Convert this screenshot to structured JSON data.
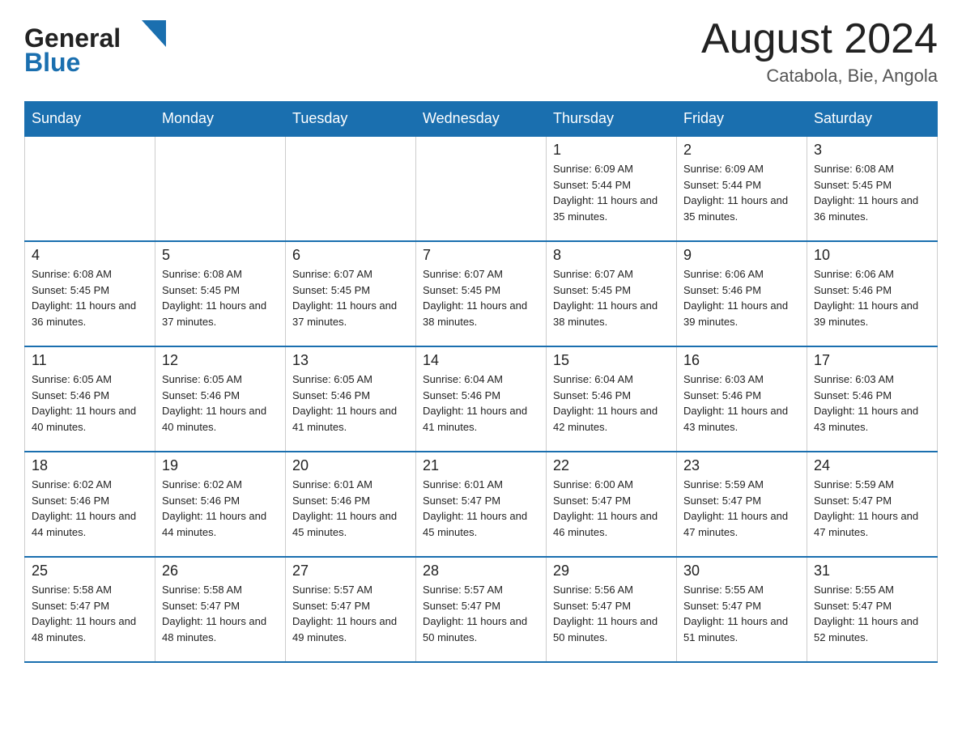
{
  "header": {
    "logo_general": "General",
    "logo_blue": "Blue",
    "month_title": "August 2024",
    "location": "Catabola, Bie, Angola"
  },
  "days_of_week": [
    "Sunday",
    "Monday",
    "Tuesday",
    "Wednesday",
    "Thursday",
    "Friday",
    "Saturday"
  ],
  "weeks": [
    [
      {
        "day": "",
        "info": ""
      },
      {
        "day": "",
        "info": ""
      },
      {
        "day": "",
        "info": ""
      },
      {
        "day": "",
        "info": ""
      },
      {
        "day": "1",
        "info": "Sunrise: 6:09 AM\nSunset: 5:44 PM\nDaylight: 11 hours and 35 minutes."
      },
      {
        "day": "2",
        "info": "Sunrise: 6:09 AM\nSunset: 5:44 PM\nDaylight: 11 hours and 35 minutes."
      },
      {
        "day": "3",
        "info": "Sunrise: 6:08 AM\nSunset: 5:45 PM\nDaylight: 11 hours and 36 minutes."
      }
    ],
    [
      {
        "day": "4",
        "info": "Sunrise: 6:08 AM\nSunset: 5:45 PM\nDaylight: 11 hours and 36 minutes."
      },
      {
        "day": "5",
        "info": "Sunrise: 6:08 AM\nSunset: 5:45 PM\nDaylight: 11 hours and 37 minutes."
      },
      {
        "day": "6",
        "info": "Sunrise: 6:07 AM\nSunset: 5:45 PM\nDaylight: 11 hours and 37 minutes."
      },
      {
        "day": "7",
        "info": "Sunrise: 6:07 AM\nSunset: 5:45 PM\nDaylight: 11 hours and 38 minutes."
      },
      {
        "day": "8",
        "info": "Sunrise: 6:07 AM\nSunset: 5:45 PM\nDaylight: 11 hours and 38 minutes."
      },
      {
        "day": "9",
        "info": "Sunrise: 6:06 AM\nSunset: 5:46 PM\nDaylight: 11 hours and 39 minutes."
      },
      {
        "day": "10",
        "info": "Sunrise: 6:06 AM\nSunset: 5:46 PM\nDaylight: 11 hours and 39 minutes."
      }
    ],
    [
      {
        "day": "11",
        "info": "Sunrise: 6:05 AM\nSunset: 5:46 PM\nDaylight: 11 hours and 40 minutes."
      },
      {
        "day": "12",
        "info": "Sunrise: 6:05 AM\nSunset: 5:46 PM\nDaylight: 11 hours and 40 minutes."
      },
      {
        "day": "13",
        "info": "Sunrise: 6:05 AM\nSunset: 5:46 PM\nDaylight: 11 hours and 41 minutes."
      },
      {
        "day": "14",
        "info": "Sunrise: 6:04 AM\nSunset: 5:46 PM\nDaylight: 11 hours and 41 minutes."
      },
      {
        "day": "15",
        "info": "Sunrise: 6:04 AM\nSunset: 5:46 PM\nDaylight: 11 hours and 42 minutes."
      },
      {
        "day": "16",
        "info": "Sunrise: 6:03 AM\nSunset: 5:46 PM\nDaylight: 11 hours and 43 minutes."
      },
      {
        "day": "17",
        "info": "Sunrise: 6:03 AM\nSunset: 5:46 PM\nDaylight: 11 hours and 43 minutes."
      }
    ],
    [
      {
        "day": "18",
        "info": "Sunrise: 6:02 AM\nSunset: 5:46 PM\nDaylight: 11 hours and 44 minutes."
      },
      {
        "day": "19",
        "info": "Sunrise: 6:02 AM\nSunset: 5:46 PM\nDaylight: 11 hours and 44 minutes."
      },
      {
        "day": "20",
        "info": "Sunrise: 6:01 AM\nSunset: 5:46 PM\nDaylight: 11 hours and 45 minutes."
      },
      {
        "day": "21",
        "info": "Sunrise: 6:01 AM\nSunset: 5:47 PM\nDaylight: 11 hours and 45 minutes."
      },
      {
        "day": "22",
        "info": "Sunrise: 6:00 AM\nSunset: 5:47 PM\nDaylight: 11 hours and 46 minutes."
      },
      {
        "day": "23",
        "info": "Sunrise: 5:59 AM\nSunset: 5:47 PM\nDaylight: 11 hours and 47 minutes."
      },
      {
        "day": "24",
        "info": "Sunrise: 5:59 AM\nSunset: 5:47 PM\nDaylight: 11 hours and 47 minutes."
      }
    ],
    [
      {
        "day": "25",
        "info": "Sunrise: 5:58 AM\nSunset: 5:47 PM\nDaylight: 11 hours and 48 minutes."
      },
      {
        "day": "26",
        "info": "Sunrise: 5:58 AM\nSunset: 5:47 PM\nDaylight: 11 hours and 48 minutes."
      },
      {
        "day": "27",
        "info": "Sunrise: 5:57 AM\nSunset: 5:47 PM\nDaylight: 11 hours and 49 minutes."
      },
      {
        "day": "28",
        "info": "Sunrise: 5:57 AM\nSunset: 5:47 PM\nDaylight: 11 hours and 50 minutes."
      },
      {
        "day": "29",
        "info": "Sunrise: 5:56 AM\nSunset: 5:47 PM\nDaylight: 11 hours and 50 minutes."
      },
      {
        "day": "30",
        "info": "Sunrise: 5:55 AM\nSunset: 5:47 PM\nDaylight: 11 hours and 51 minutes."
      },
      {
        "day": "31",
        "info": "Sunrise: 5:55 AM\nSunset: 5:47 PM\nDaylight: 11 hours and 52 minutes."
      }
    ]
  ]
}
